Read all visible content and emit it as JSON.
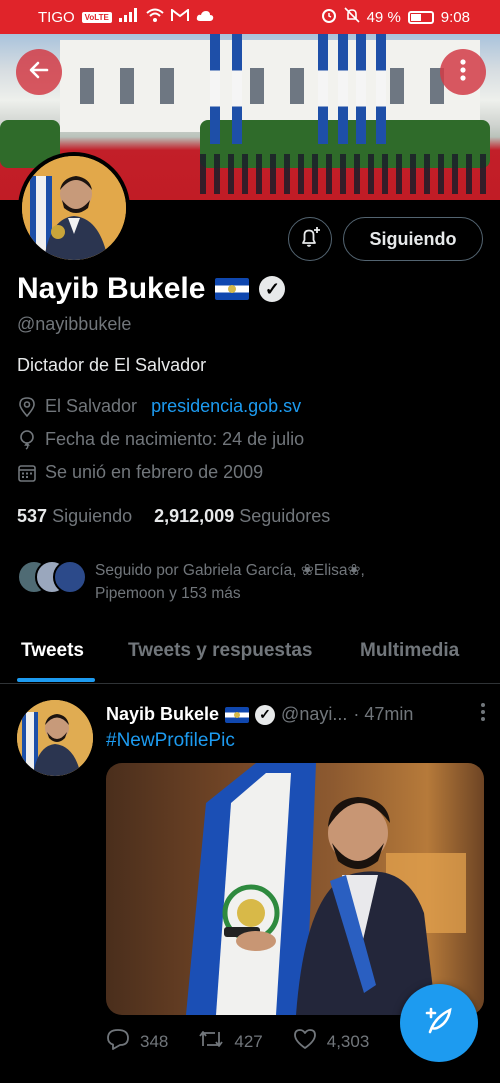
{
  "status_bar": {
    "carrier": "TIGO",
    "volte": "VoLTE",
    "battery_percent": "49 %",
    "time": "9:08"
  },
  "profile": {
    "name": "Nayib Bukele",
    "handle": "@nayibbukele",
    "bio": "Dictador de El Salvador",
    "location": "El Salvador",
    "website": "presidencia.gob.sv",
    "birthday": "Fecha de nacimiento: 24 de julio",
    "joined": "Se unió en febrero de 2009",
    "following_count": "537",
    "following_label": "Siguiendo",
    "followers_count": "2,912,009",
    "followers_label": "Seguidores",
    "followed_by_line1": "Seguido por Gabriela García, ❀Elisa❀,",
    "followed_by_line2": "Pipemoon y 153 más",
    "follow_button": "Siguiendo"
  },
  "tabs": [
    {
      "label": "Tweets",
      "active": true
    },
    {
      "label": "Tweets y respuestas",
      "active": false
    },
    {
      "label": "Multimedia",
      "active": false
    }
  ],
  "tweet": {
    "name": "Nayib Bukele",
    "handle": "@nayi...",
    "time": "· 47min",
    "text": "#NewProfilePic",
    "replies": "348",
    "retweets": "427",
    "likes": "4,303"
  },
  "colors": {
    "status_bar": "#e0242a",
    "accent": "#1d9bf0",
    "background": "#000000",
    "muted_text": "#71767b"
  }
}
